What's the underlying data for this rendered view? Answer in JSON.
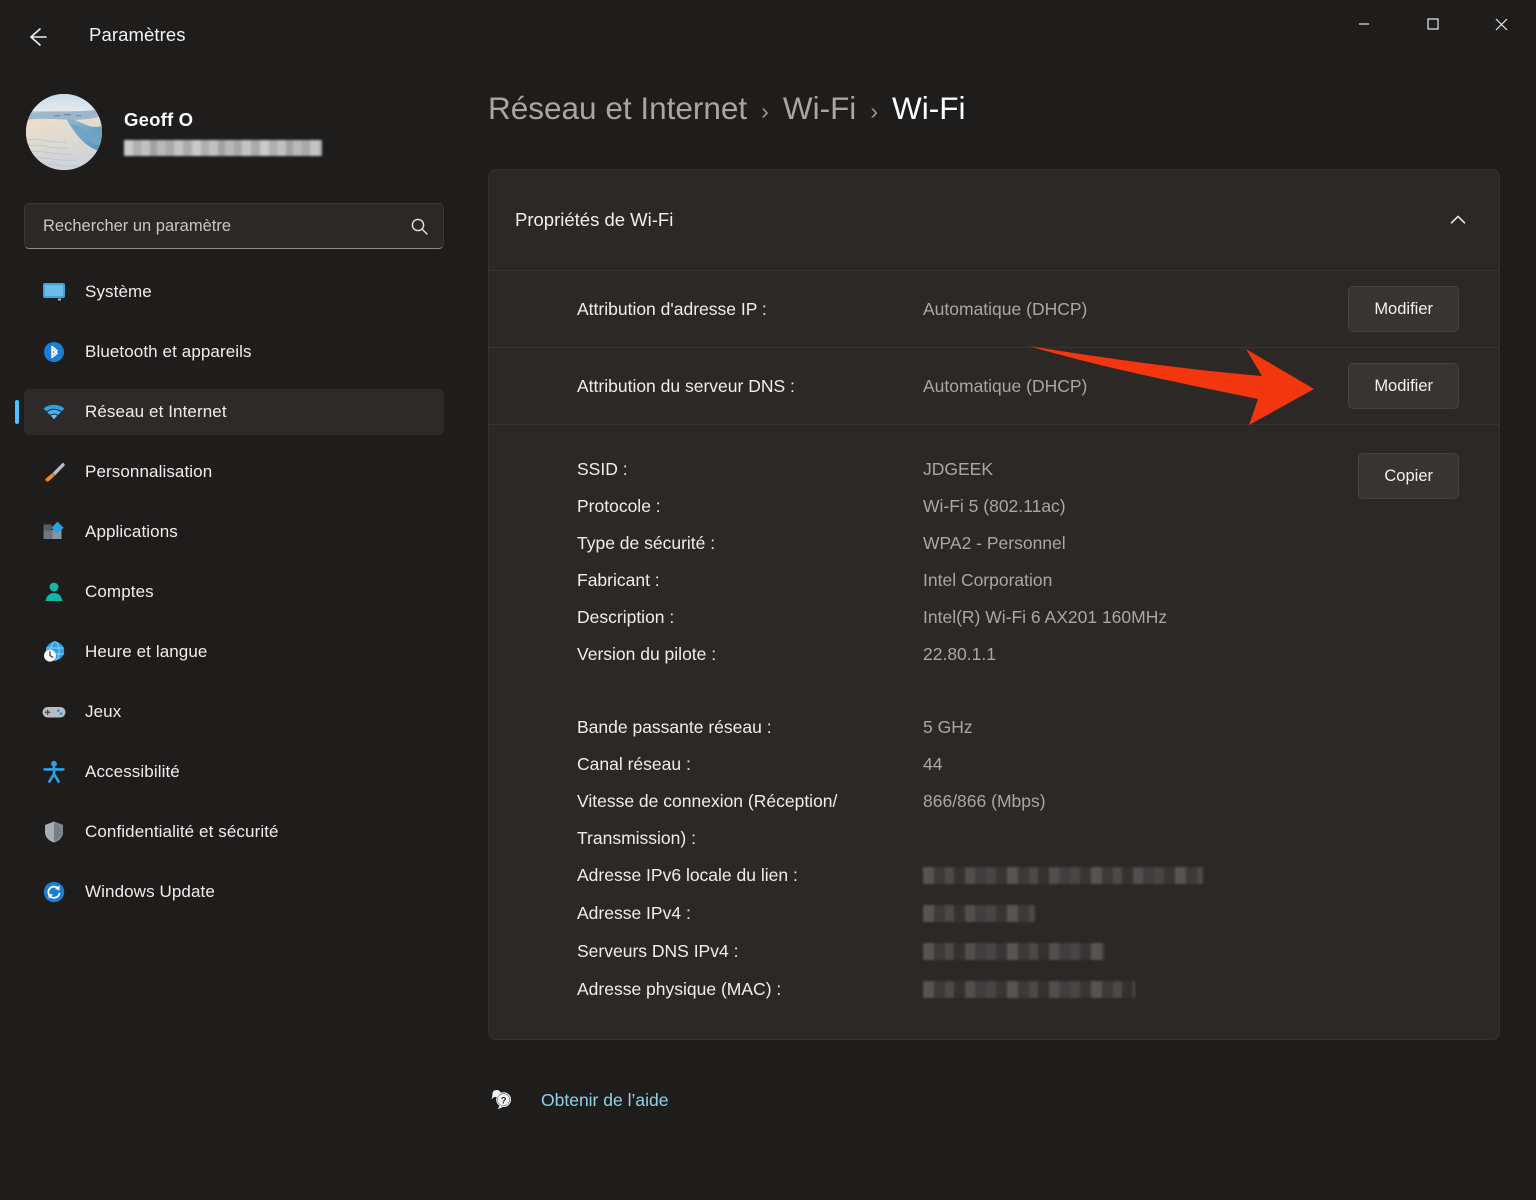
{
  "window": {
    "title": "Paramètres",
    "back_icon": "back-arrow-icon",
    "minimize_label": "—",
    "maximize_label": "□",
    "close_label": "✕"
  },
  "profile": {
    "name": "Geoff O",
    "email_redacted": true,
    "avatar_icon": "user-avatar-dune-photo"
  },
  "search": {
    "placeholder": "Rechercher un paramètre",
    "value": "",
    "icon": "search-icon"
  },
  "sidebar": {
    "items": [
      {
        "label": "Système",
        "icon": "monitor-icon",
        "selected": false
      },
      {
        "label": "Bluetooth et appareils",
        "icon": "bluetooth-icon",
        "selected": false
      },
      {
        "label": "Réseau et Internet",
        "icon": "wifi-icon",
        "selected": true
      },
      {
        "label": "Personnalisation",
        "icon": "paintbrush-icon",
        "selected": false
      },
      {
        "label": "Applications",
        "icon": "apps-icon",
        "selected": false
      },
      {
        "label": "Comptes",
        "icon": "person-icon",
        "selected": false
      },
      {
        "label": "Heure et langue",
        "icon": "clock-globe-icon",
        "selected": false
      },
      {
        "label": "Jeux",
        "icon": "gamepad-icon",
        "selected": false
      },
      {
        "label": "Accessibilité",
        "icon": "accessibility-person-icon",
        "selected": false
      },
      {
        "label": "Confidentialité et sécurité",
        "icon": "shield-icon",
        "selected": false
      },
      {
        "label": "Windows Update",
        "icon": "update-refresh-icon",
        "selected": false
      }
    ]
  },
  "breadcrumb": {
    "items": [
      "Réseau et Internet",
      "Wi-Fi",
      "Wi-Fi"
    ],
    "separator": "›",
    "current_index": 2
  },
  "card": {
    "title": "Propriétés de Wi-Fi",
    "collapse_icon": "chevron-up-icon",
    "expanded": true,
    "rows": [
      {
        "label": "Attribution d'adresse IP :",
        "value": "Automatique (DHCP)",
        "button": "Modifier"
      },
      {
        "label": "Attribution du serveur DNS :",
        "value": "Automatique (DHCP)",
        "button": "Modifier",
        "highlighted": true
      }
    ],
    "copy_button": "Copier",
    "details_group_1": [
      {
        "label": "SSID :",
        "value": "JDGEEK"
      },
      {
        "label": "Protocole :",
        "value": "Wi-Fi 5 (802.11ac)"
      },
      {
        "label": "Type de sécurité :",
        "value": "WPA2 - Personnel"
      },
      {
        "label": "Fabricant :",
        "value": "Intel Corporation"
      },
      {
        "label": "Description :",
        "value": "Intel(R) Wi-Fi 6 AX201 160MHz"
      },
      {
        "label": "Version du pilote :",
        "value": "22.80.1.1"
      }
    ],
    "details_group_2": [
      {
        "label": "Bande passante réseau :",
        "value": "5 GHz"
      },
      {
        "label": "Canal réseau :",
        "value": "44"
      },
      {
        "label": "Vitesse de connexion (Réception/\nTransmission) :",
        "value": "866/866 (Mbps)",
        "two_line": true
      },
      {
        "label": "Adresse IPv6 locale du lien :",
        "value": "",
        "redacted": true,
        "redact_width": 280
      },
      {
        "label": "Adresse IPv4 :",
        "value": "",
        "redacted": true,
        "redact_width": 112
      },
      {
        "label": "Serveurs DNS IPv4 :",
        "value": "",
        "redacted": true,
        "redact_width": 182
      },
      {
        "label": "Adresse physique (MAC) :",
        "value": "",
        "redacted": true,
        "redact_width": 212
      }
    ]
  },
  "help": {
    "label": "Obtenir de l’aide",
    "icon": "help-question-bubble-icon"
  },
  "annotation": {
    "type": "arrow",
    "color": "#f4360f",
    "points_to": "Modifier button of DNS row"
  },
  "colors": {
    "page_background": "#1f1d1c",
    "card_background": "#2b2826",
    "accent": "#4cc2ff",
    "link": "#8cd3e8",
    "annotation_red": "#f4360f"
  }
}
